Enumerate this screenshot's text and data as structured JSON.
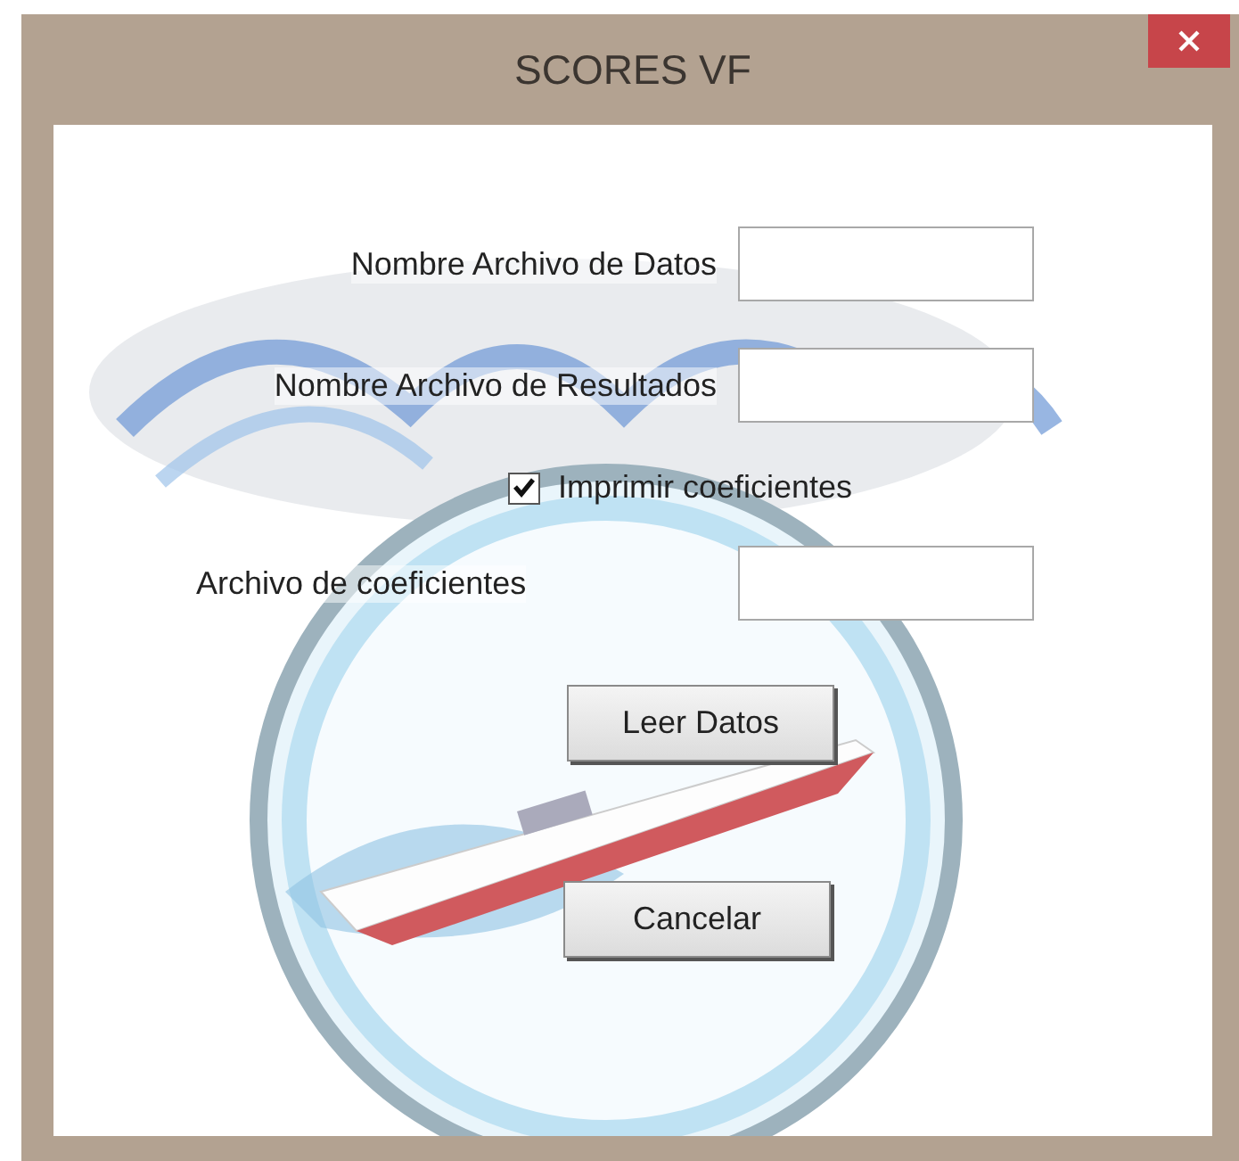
{
  "window": {
    "title": "SCORES VF"
  },
  "fields": [
    {
      "label": "Nombre Archivo de Datos"
    },
    {
      "label": "Nombre Archivo de Resultados"
    },
    {
      "label": "Archivo de coeficientes"
    }
  ],
  "checkbox": {
    "label": "Imprimir coeficientes",
    "checked": true
  },
  "buttons": [
    "Leer Datos",
    "Cancelar"
  ]
}
